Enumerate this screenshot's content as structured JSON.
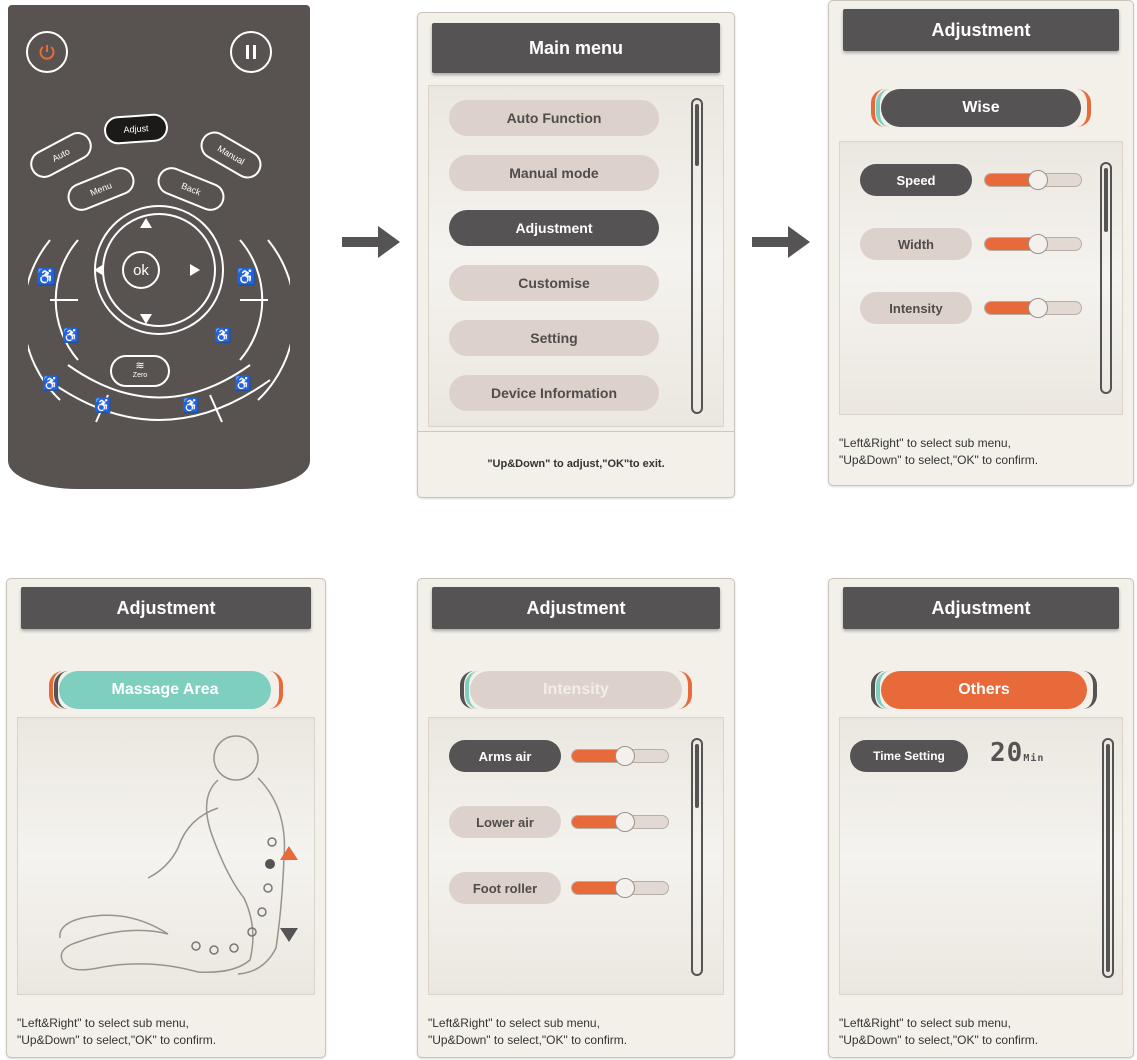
{
  "remote": {
    "buttons": {
      "adjust": "Adjust",
      "auto": "Auto",
      "manual": "Manual",
      "menu": "Menu",
      "back": "Back",
      "ok": "ok",
      "zero": "Zero"
    }
  },
  "main_menu": {
    "title": "Main menu",
    "items": [
      "Auto Function",
      "Manual mode",
      "Adjustment",
      "Customise",
      "Setting",
      "Device Information"
    ],
    "footer": "\"Up&Down\" to adjust,\"OK\"to exit."
  },
  "adjust_wise": {
    "title": "Adjustment",
    "tab": "Wise",
    "settings": [
      {
        "label": "Speed",
        "level": 0.55
      },
      {
        "label": "Width",
        "level": 0.55
      },
      {
        "label": "Intensity",
        "level": 0.55
      }
    ],
    "footer_line1": "\"Left&Right\" to select sub menu,",
    "footer_line2": "\"Up&Down\" to select,\"OK\" to confirm."
  },
  "adjust_area": {
    "title": "Adjustment",
    "tab": "Massage Area",
    "footer_line1": "\"Left&Right\" to select sub menu,",
    "footer_line2": "\"Up&Down\" to select,\"OK\" to confirm."
  },
  "adjust_intensity": {
    "title": "Adjustment",
    "tab": "Intensity",
    "settings": [
      {
        "label": "Arms air",
        "level": 0.55
      },
      {
        "label": "Lower air",
        "level": 0.55
      },
      {
        "label": "Foot roller",
        "level": 0.55
      }
    ],
    "footer_line1": "\"Left&Right\" to select sub menu,",
    "footer_line2": "\"Up&Down\" to select,\"OK\" to confirm."
  },
  "adjust_others": {
    "title": "Adjustment",
    "tab": "Others",
    "time_label": "Time Setting",
    "time_value": "20",
    "time_unit": "Min",
    "footer_line1": "\"Left&Right\" to select sub menu,",
    "footer_line2": "\"Up&Down\" to select,\"OK\" to confirm."
  },
  "colors": {
    "dark": "#555353",
    "accent_orange": "#e8693a",
    "accent_teal": "#7ecfc0",
    "pill_light": "#ddd1cc"
  }
}
